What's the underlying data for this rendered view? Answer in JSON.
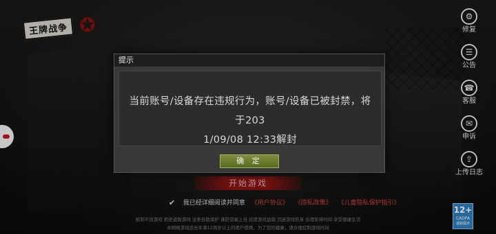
{
  "logo": {
    "text": "王牌战争"
  },
  "side_menu": [
    {
      "label": "修复",
      "icon": "gear-icon"
    },
    {
      "label": "公告",
      "icon": "notice-icon"
    },
    {
      "label": "客服",
      "icon": "headset-icon"
    },
    {
      "label": "申诉",
      "icon": "chat-icon"
    },
    {
      "label": "上传日志",
      "icon": "upload-icon"
    }
  ],
  "dialog": {
    "title": "提示",
    "message_line1": "当前账号/设备存在违规行为，账号/设备已被封禁，将于203",
    "message_line2": "1/09/08 12:33解封",
    "confirm_label": "确 定"
  },
  "start_button": {
    "label": "开始游戏"
  },
  "agreement": {
    "text": "我已经详细阅读并同意",
    "link_user": "《用户协议》",
    "link_privacy": "《隐私政策》",
    "link_child": "《儿童隐私保护指引》"
  },
  "footer": {
    "line1": "抵制不良游戏  拒绝盗版游戏  注意自我保护  谨防受骗上当  适度游戏益脑  沉迷游戏伤身  合理安排时间  享受健康生活",
    "line2": "本网络游戏适合年满12周岁以上的用户使用，为了您的健康，请合理控制游戏时间"
  },
  "age_rating": {
    "number": "12+",
    "line1": "CADPA",
    "line2": "适龄提示"
  },
  "colors": {
    "accent_red": "#c1121f",
    "confirm_green": "#6b7c2f",
    "age_blue": "#2f7fbf"
  }
}
